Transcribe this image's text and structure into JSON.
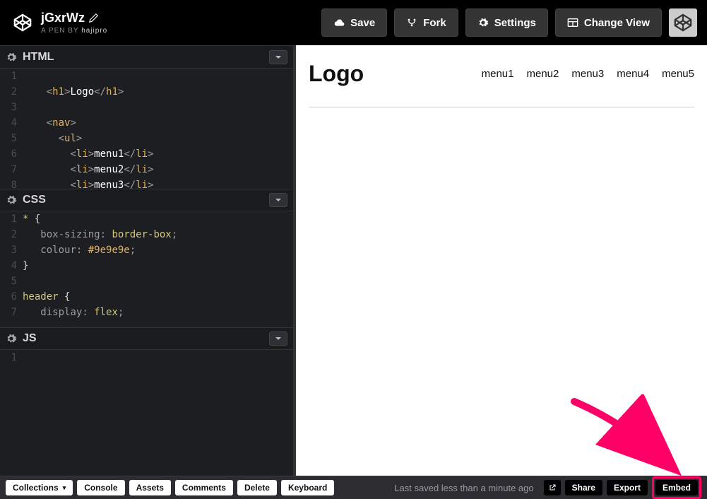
{
  "header": {
    "pen_title": "jGxrWz",
    "byline_prefix": "A PEN BY ",
    "author": "hajipro",
    "buttons": {
      "save": "Save",
      "fork": "Fork",
      "settings": "Settings",
      "change_view": "Change View"
    }
  },
  "panels": {
    "html": {
      "title": "HTML"
    },
    "css": {
      "title": "CSS"
    },
    "js": {
      "title": "JS"
    }
  },
  "code": {
    "html": [
      {
        "n": "1",
        "segs": []
      },
      {
        "n": "2",
        "segs": [
          [
            "in",
            "    "
          ],
          [
            "b",
            "<"
          ],
          [
            "t",
            "h1"
          ],
          [
            "b",
            ">"
          ],
          [
            "x",
            "Logo"
          ],
          [
            "b",
            "</"
          ],
          [
            "t",
            "h1"
          ],
          [
            "b",
            ">"
          ]
        ]
      },
      {
        "n": "3",
        "segs": []
      },
      {
        "n": "4",
        "segs": [
          [
            "in",
            "    "
          ],
          [
            "b",
            "<"
          ],
          [
            "t",
            "nav"
          ],
          [
            "b",
            ">"
          ]
        ]
      },
      {
        "n": "5",
        "segs": [
          [
            "in",
            "      "
          ],
          [
            "b",
            "<"
          ],
          [
            "t",
            "ul"
          ],
          [
            "b",
            ">"
          ]
        ]
      },
      {
        "n": "6",
        "segs": [
          [
            "in",
            "        "
          ],
          [
            "b",
            "<"
          ],
          [
            "t",
            "li"
          ],
          [
            "b",
            ">"
          ],
          [
            "x",
            "menu1"
          ],
          [
            "b",
            "</"
          ],
          [
            "t",
            "li"
          ],
          [
            "b",
            ">"
          ]
        ]
      },
      {
        "n": "7",
        "segs": [
          [
            "in",
            "        "
          ],
          [
            "b",
            "<"
          ],
          [
            "t",
            "li"
          ],
          [
            "b",
            ">"
          ],
          [
            "x",
            "menu2"
          ],
          [
            "b",
            "</"
          ],
          [
            "t",
            "li"
          ],
          [
            "b",
            ">"
          ]
        ]
      },
      {
        "n": "8",
        "segs": [
          [
            "in",
            "        "
          ],
          [
            "b",
            "<"
          ],
          [
            "t",
            "li"
          ],
          [
            "b",
            ">"
          ],
          [
            "x",
            "menu3"
          ],
          [
            "b",
            "</"
          ],
          [
            "t",
            "li"
          ],
          [
            "b",
            ">"
          ]
        ]
      }
    ],
    "css": [
      {
        "n": "1",
        "segs": [
          [
            "s",
            "* "
          ],
          [
            "br",
            "{"
          ]
        ]
      },
      {
        "n": "2",
        "segs": [
          [
            "in",
            "   "
          ],
          [
            "p",
            "box-sizing"
          ],
          [
            "pu",
            ": "
          ],
          [
            "v",
            "border-box"
          ],
          [
            "pu",
            ";"
          ]
        ]
      },
      {
        "n": "3",
        "segs": [
          [
            "in",
            "   "
          ],
          [
            "p",
            "colour"
          ],
          [
            "pu",
            ": "
          ],
          [
            "h",
            "#9e9e9e"
          ],
          [
            "pu",
            ";"
          ]
        ]
      },
      {
        "n": "4",
        "segs": [
          [
            "br",
            "}"
          ]
        ]
      },
      {
        "n": "5",
        "segs": []
      },
      {
        "n": "6",
        "segs": [
          [
            "s",
            "header "
          ],
          [
            "br",
            "{"
          ]
        ]
      },
      {
        "n": "7",
        "segs": [
          [
            "in",
            "   "
          ],
          [
            "p",
            "display"
          ],
          [
            "pu",
            ": "
          ],
          [
            "v",
            "flex"
          ],
          [
            "pu",
            ";"
          ]
        ]
      }
    ],
    "js": [
      {
        "n": "1",
        "segs": []
      }
    ]
  },
  "preview": {
    "logo": "Logo",
    "menu": [
      "menu1",
      "menu2",
      "menu3",
      "menu4",
      "menu5"
    ]
  },
  "footer": {
    "collections": "Collections",
    "console": "Console",
    "assets": "Assets",
    "comments": "Comments",
    "delete": "Delete",
    "keyboard": "Keyboard",
    "status": "Last saved less than a minute ago",
    "share": "Share",
    "export": "Export",
    "embed": "Embed"
  }
}
